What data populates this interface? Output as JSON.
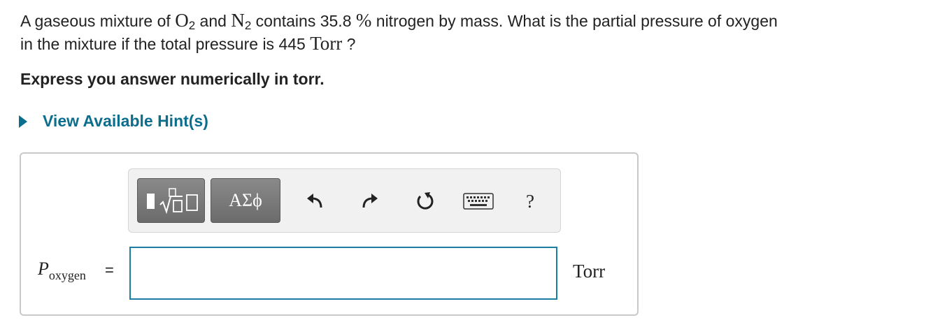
{
  "question": {
    "text_1": "A gaseous mixture of ",
    "o2_symbol": "O",
    "o2_sub": "2",
    "text_2": " and ",
    "n2_symbol": "N",
    "n2_sub": "2",
    "text_3": " contains 35.8 ",
    "percent": "%",
    "text_4": " nitrogen by mass. What is the partial pressure of oxygen",
    "text_5": "in the mixture if the total pressure is 445 ",
    "unit": "Torr",
    "text_6": " ?"
  },
  "instruction": "Express you answer numerically in torr.",
  "hint": {
    "label": "View Available Hint(s)"
  },
  "toolbar": {
    "greek_label": "ΑΣϕ",
    "help_label": "?",
    "icons": [
      "templates-icon",
      "undo-icon",
      "redo-icon",
      "reset-icon",
      "keyboard-icon",
      "help-icon"
    ]
  },
  "answer": {
    "var_symbol": "P",
    "var_sub": "oxygen",
    "equals": "=",
    "value": "",
    "unit": "Torr"
  },
  "colors": {
    "link": "#0b6e8c",
    "input_border": "#1c7ea0",
    "toolbar_button": "#7a7a7a"
  }
}
